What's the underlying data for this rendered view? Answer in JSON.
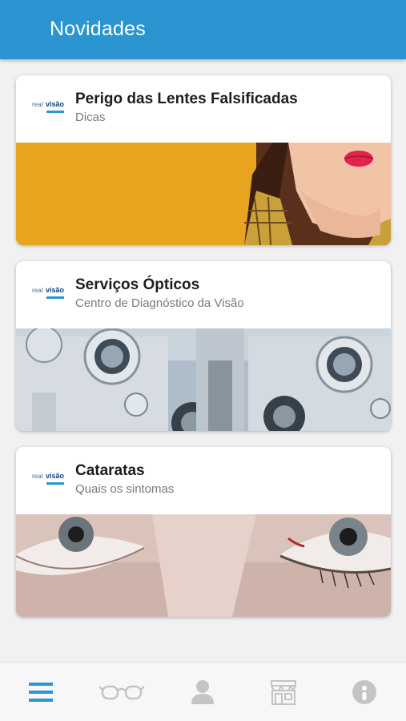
{
  "header": {
    "title": "Novidades"
  },
  "logo": {
    "part1": "real",
    "part2": "visão"
  },
  "cards": [
    {
      "title": "Perigo das Lentes Falsificadas",
      "subtitle": "Dicas"
    },
    {
      "title": "Serviços Ópticos",
      "subtitle": "Centro de Diagnóstico da Visão"
    },
    {
      "title": "Cataratas",
      "subtitle": "Quais os sintomas"
    }
  ],
  "nav": {
    "items": [
      {
        "icon": "menu-icon",
        "active": true
      },
      {
        "icon": "glasses-icon",
        "active": false
      },
      {
        "icon": "profile-icon",
        "active": false
      },
      {
        "icon": "store-icon",
        "active": false
      },
      {
        "icon": "info-icon",
        "active": false
      }
    ]
  },
  "colors": {
    "primary": "#2a95d0",
    "nav_inactive": "#c4c4c4",
    "banner_yellow": "#e8a21d"
  }
}
